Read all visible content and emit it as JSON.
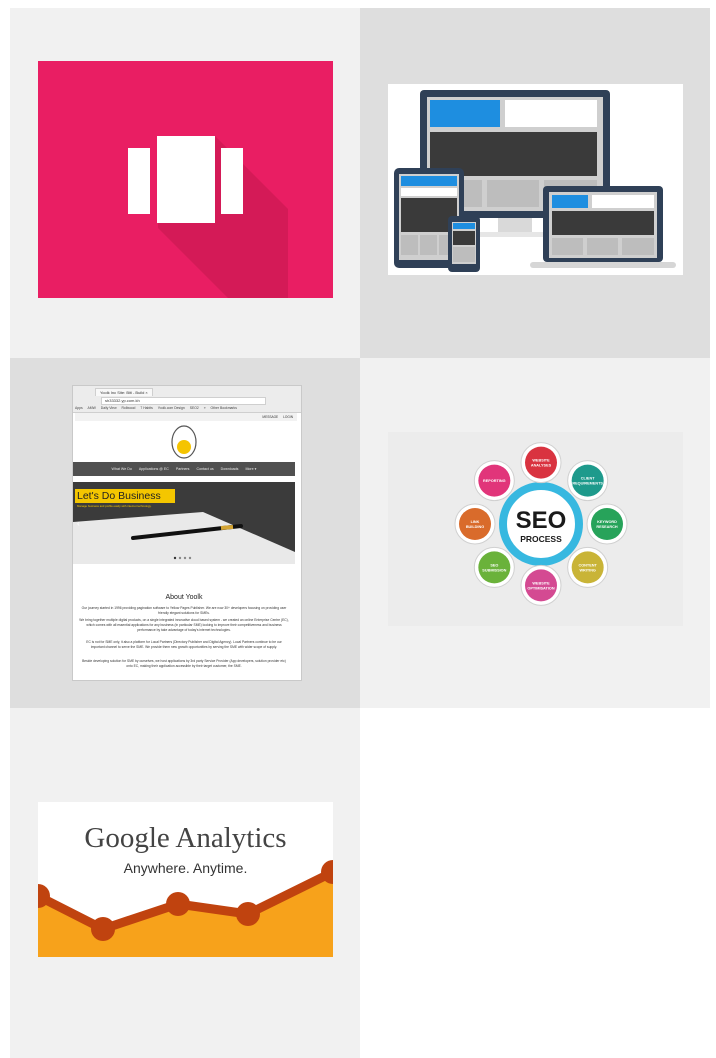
{
  "gallery": {
    "website_screenshot": {
      "tab_title": "Yoolk Inc Site: Biti - Build ×",
      "url": "sh33332.yp.com.kh",
      "bookmarks": [
        "Apps",
        "AMW",
        "Daily View",
        "Rollwood",
        "7 Habits",
        "Yoolk.com Design",
        "SEO2",
        "»",
        "Other Bookmarks"
      ],
      "top_links": [
        "MESSAGE",
        "LOGIN"
      ],
      "nav": [
        "What We Do",
        "Applications @ EC",
        "Partners",
        "Contact us",
        "Downloads",
        "More ▾"
      ],
      "hero_heading": "Let's Do Business",
      "hero_subtext": "Manage business and profile easily with internet technology.",
      "about_title": "About Yoolk",
      "about_paragraphs": [
        "Our journey started in 1996 providing pagination software to Yellow Pages Publisher. We are now 30+ developers focusing on providing user friendly elegant solutions for SMEs.",
        "We bring together multiple digital products, on a single integrated innovative cloud based system - we created an online Enterprise Centre (EC), which comes with all essential applications for any business (in particular SME) looking to improve their competitiveness and business performance by take advantage of today's internet technologies.",
        "EC is not for SME only, it also a platform for Local Partners (Directory Publisher and Digital Agency). Local Partners continue to be our important channel to serve the SME. We provide them new growth opportunities by serving the SME with wider scope of supply.",
        "Beside developing solution for SME by ourselves, we host applications by 3rd party Service Provider (App developers, solution provider etc) onto EC, making their application accessible by their target customer, the SME."
      ]
    },
    "seo": {
      "center_title": "SEO",
      "center_subtitle": "PROCESS",
      "steps": [
        "WEBSITE ANALYSES",
        "CLIENT REQUIREMENTS",
        "KEYWORD RESEARCH",
        "CONTENT WRITING",
        "WEBSITE OPTIMISATION",
        "SEO SUBMISSION",
        "LINK BUILDING",
        "REPORTING"
      ],
      "colors": [
        "#d93340",
        "#1e9a8c",
        "#27a35a",
        "#c9b437",
        "#d44a92",
        "#6ab23a",
        "#d96b2b",
        "#e1357a"
      ]
    },
    "analytics": {
      "title": "Google Analytics",
      "subtitle": "Anywhere. Anytime.",
      "orange": "#f7a21b",
      "line_color": "#c0430f"
    },
    "colors": {
      "carousel_bg": "#e91e63",
      "device_blue": "#1e8ee0",
      "device_frame": "#2f4057"
    }
  }
}
